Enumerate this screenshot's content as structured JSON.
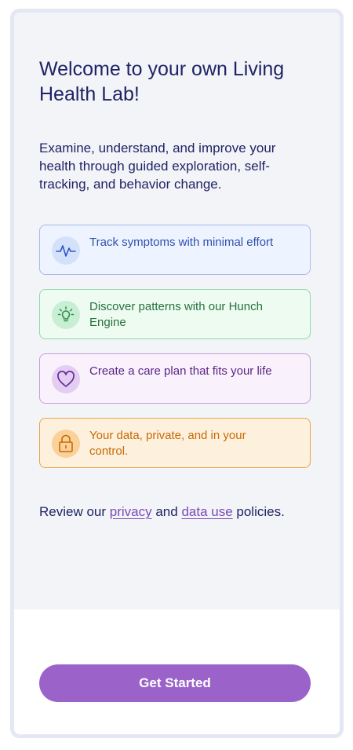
{
  "welcome": {
    "title": "Welcome to your own Living Health Lab!",
    "intro": "Examine, understand, and improve your health through guided exploration, self-tracking, and behavior change."
  },
  "features": [
    {
      "icon": "pulse-icon",
      "label": "Track symptoms with minimal effort",
      "color": "#2f4fb0"
    },
    {
      "icon": "lightbulb-icon",
      "label": "Discover patterns with our Hunch Engine",
      "color": "#27703c"
    },
    {
      "icon": "heart-icon",
      "label": "Create a care plan that fits your life",
      "color": "#5a2582"
    },
    {
      "icon": "lock-icon",
      "label": "Your data, private, and in your control.",
      "color": "#c76b05"
    }
  ],
  "policy": {
    "prefix": "Review our ",
    "privacy_link": "privacy",
    "middle": " and ",
    "data_use_link": "data use",
    "suffix": " policies."
  },
  "cta": {
    "label": "Get Started",
    "color": "#9b63ca"
  }
}
